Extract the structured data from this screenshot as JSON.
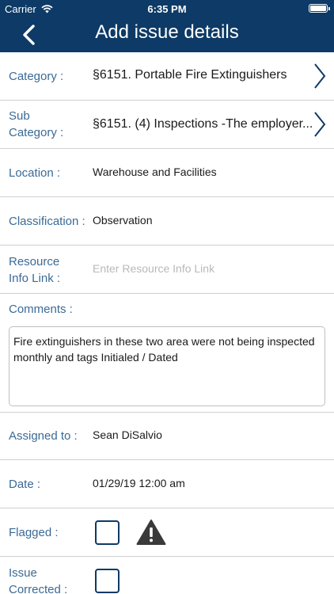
{
  "status_bar": {
    "carrier": "Carrier",
    "time": "6:35 PM"
  },
  "header": {
    "title": "Add issue details"
  },
  "rows": {
    "category": {
      "label": "Category :",
      "value": "§6151. Portable Fire Extinguishers"
    },
    "sub_category": {
      "label_line1": "Sub",
      "label_line2": "Category :",
      "value": "§6151. (4) Inspections -The employer..."
    },
    "location": {
      "label": "Location :",
      "value": "Warehouse and Facilities"
    },
    "classification": {
      "label": "Classification :",
      "value": "Observation"
    },
    "resource_info_link": {
      "label_line1": "Resource",
      "label_line2": "Info Link :",
      "placeholder": "Enter Resource Info Link"
    },
    "comments": {
      "label": "Comments :",
      "value": "Fire extinguishers in these two area were not being inspected monthly and tags Initialed / Dated"
    },
    "assigned_to": {
      "label": "Assigned to :",
      "value": "Sean DiSalvio"
    },
    "date": {
      "label": "Date :",
      "value": "01/29/19 12:00 am"
    },
    "flagged": {
      "label": "Flagged :",
      "checked": false
    },
    "issue_corrected": {
      "label_line1": "Issue",
      "label_line2": "Corrected :",
      "checked": false
    }
  },
  "colors": {
    "header_bg": "#0d3a66",
    "label_text": "#3b6a96",
    "divider": "#cfcfcf",
    "warning_icon": "#3a3a3a"
  },
  "icons": {
    "back": "chevron-left-icon",
    "disclosure": "chevron-right-icon",
    "warning": "warning-triangle-icon"
  }
}
